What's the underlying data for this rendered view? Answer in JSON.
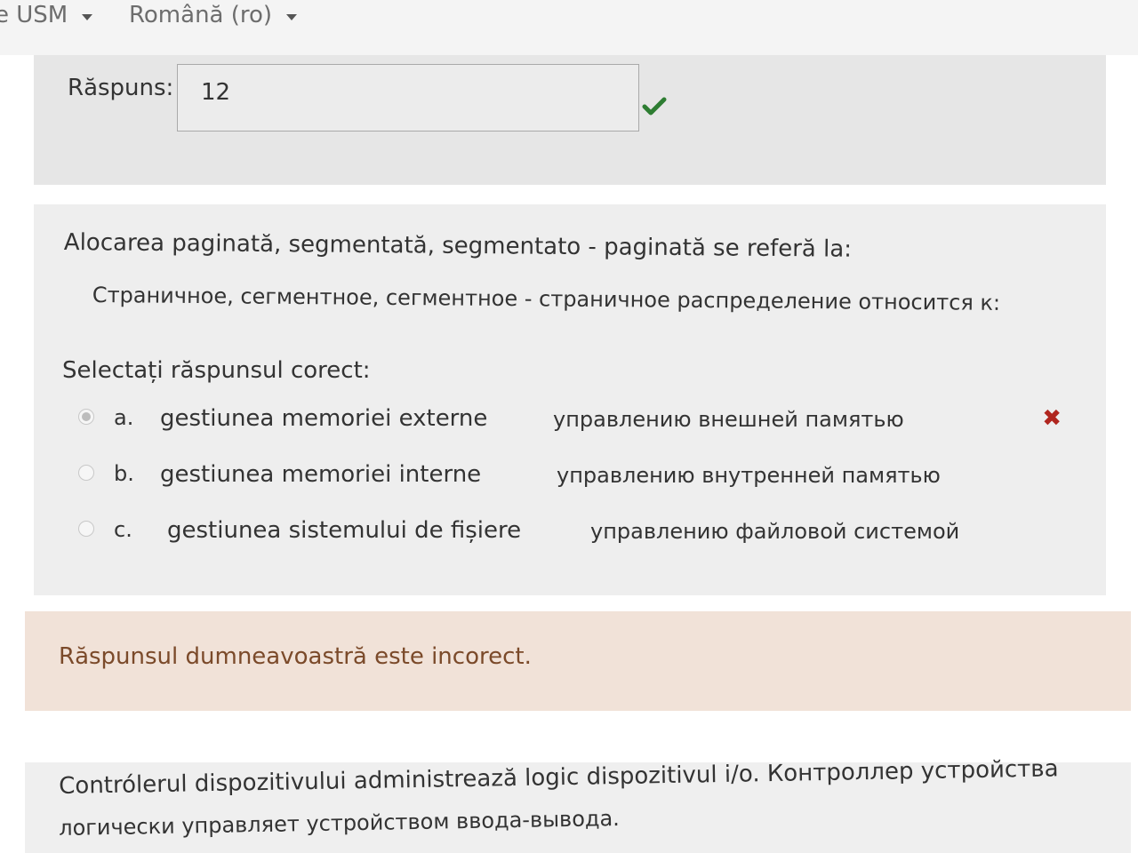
{
  "topbar": {
    "site_menu": "e USM",
    "language_menu": "Română (ro)"
  },
  "previous_question": {
    "answer_label": "Răspuns:",
    "answer_value": "12",
    "status_icon": "check-icon",
    "status_color": "#2e7d32"
  },
  "question": {
    "text_ro": "Alocarea paginată, segmentată, segmentato - paginată se referă la:",
    "text_ru": "Страничное, сегментное, сегментное - страничное распределение относится к:",
    "prompt": "Selectați răspunsul corect:",
    "options": [
      {
        "letter": "a.",
        "text_ro": "gestiunea memoriei externe",
        "text_ru": "управлению внешней памятью",
        "selected": true,
        "result": "incorrect"
      },
      {
        "letter": "b.",
        "text_ro": "gestiunea memoriei interne",
        "text_ru": "управлению внутренней памятью",
        "selected": false
      },
      {
        "letter": "c.",
        "text_ro": "gestiunea sistemului de fișiere",
        "text_ru": "управлению файловой системой",
        "selected": false
      }
    ],
    "wrong_mark": "✖",
    "wrong_color": "#b0261f"
  },
  "feedback": {
    "text": "Răspunsul dumneavoastră este incorect.",
    "background": "#f1e2d8"
  },
  "next_question": {
    "text_ro": "Contrólerul dispozitivului administrează logic dispozitivul i/o.   Контроллер устройства",
    "text_ru": "логически управляет устройством ввода-вывода."
  }
}
